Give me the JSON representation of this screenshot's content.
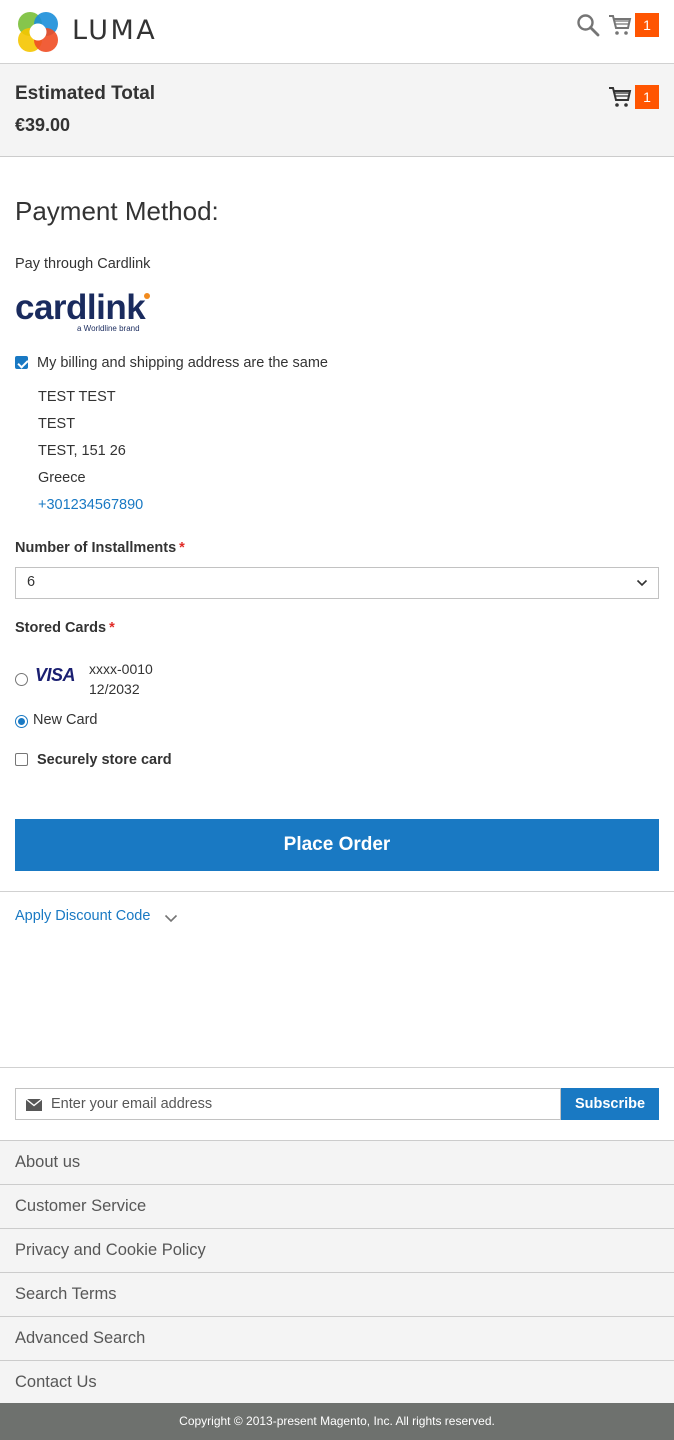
{
  "header": {
    "brand": "LUMA",
    "search_icon": "search-icon",
    "cart_icon": "cart-icon",
    "cart_count": "1"
  },
  "summary": {
    "title": "Estimated Total",
    "amount": "€39.00",
    "cart_count": "1"
  },
  "payment": {
    "title": "Payment Method:",
    "method_label": "Pay through Cardlink",
    "logo": {
      "name": "cardlink",
      "tagline": "a Worldline brand"
    },
    "same_address_label": "My billing and shipping address are the same",
    "same_address_checked": true,
    "address": {
      "name": "TEST TEST",
      "street": "TEST",
      "city_line": "TEST, 151 26",
      "country": "Greece",
      "phone": "+301234567890"
    },
    "installments": {
      "label": "Number of Installments",
      "required_mark": "*",
      "value": "6"
    },
    "stored_cards": {
      "label": "Stored Cards",
      "required_mark": "*",
      "cards": [
        {
          "brand": "VISA",
          "number": "xxxx-0010",
          "expiry": "12/2032",
          "selected": false
        }
      ],
      "new_card_label": "New Card",
      "new_card_selected": true
    },
    "store_card_label": "Securely store card",
    "store_card_checked": false,
    "place_order_label": "Place Order"
  },
  "discount": {
    "label": "Apply Discount Code"
  },
  "footer": {
    "newsletter_placeholder": "Enter your email address",
    "subscribe_label": "Subscribe",
    "links": [
      "About us",
      "Customer Service",
      "Privacy and Cookie Policy",
      "Search Terms",
      "Advanced Search",
      "Contact Us"
    ],
    "copyright": "Copyright © 2013-present Magento, Inc. All rights reserved."
  },
  "colors": {
    "accent": "#1979c3",
    "badge": "#ff5501",
    "summary_bg": "#f4f4f4",
    "footer_bar": "#6e716e"
  }
}
